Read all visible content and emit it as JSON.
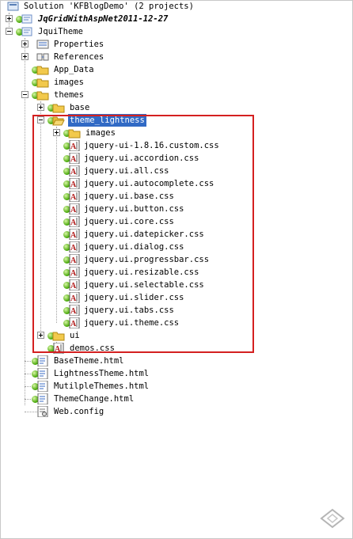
{
  "tree": {
    "solution_label": "Solution 'KFBlogDemo' (2 projects)",
    "project1_label": "JqGridWithAspNet2011-12-27",
    "project2_label": "JquiTheme",
    "properties_label": "Properties",
    "references_label": "References",
    "app_data_label": "App_Data",
    "images_label": "images",
    "themes_label": "themes",
    "base_label": "base",
    "theme_lightness_label": "theme_lightness",
    "theme_images_label": "images",
    "css_files": [
      "jquery-ui-1.8.16.custom.css",
      "jquery.ui.accordion.css",
      "jquery.ui.all.css",
      "jquery.ui.autocomplete.css",
      "jquery.ui.base.css",
      "jquery.ui.button.css",
      "jquery.ui.core.css",
      "jquery.ui.datepicker.css",
      "jquery.ui.dialog.css",
      "jquery.ui.progressbar.css",
      "jquery.ui.resizable.css",
      "jquery.ui.selectable.css",
      "jquery.ui.slider.css",
      "jquery.ui.tabs.css",
      "jquery.ui.theme.css"
    ],
    "ui_label": "ui",
    "demos_css_label": "demos.css",
    "html_files": [
      "BaseTheme.html",
      "LightnessTheme.html",
      "MutilpleThemes.html",
      "ThemeChange.html"
    ],
    "web_config_label": "Web.config"
  },
  "colors": {
    "selection": "#316ac5",
    "highlight_box": "#d42020",
    "folder": "#f2c94c",
    "status_dot": "#3fa300"
  },
  "icons": {
    "solution": "solution-icon",
    "project": "project-icon",
    "folder": "folder-icon",
    "css_file": "css-file-icon",
    "html_file": "html-file-icon",
    "config_file": "config-file-icon"
  }
}
